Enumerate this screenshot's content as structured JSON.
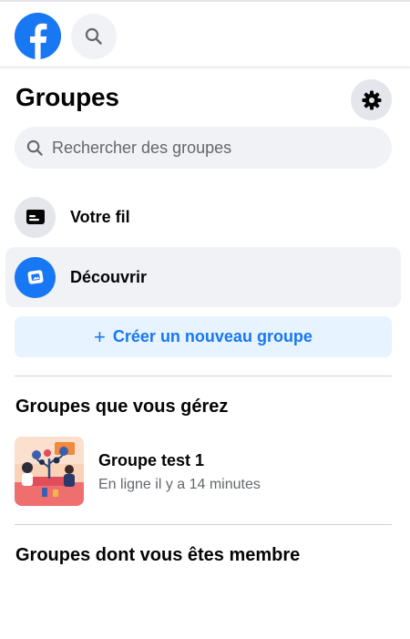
{
  "header": {
    "logo_icon": "facebook-logo-icon",
    "search_icon": "search-icon"
  },
  "page": {
    "title": "Groupes",
    "settings_icon": "gear-icon"
  },
  "search": {
    "placeholder": "Rechercher des groupes"
  },
  "nav": {
    "items": [
      {
        "label": "Votre fil",
        "icon": "feed-icon",
        "active": false
      },
      {
        "label": "Découvrir",
        "icon": "discover-icon",
        "active": true
      }
    ]
  },
  "create": {
    "label": "Créer un nouveau groupe"
  },
  "sections": {
    "managed_title": "Groupes que vous gérez",
    "member_title": "Groupes dont vous êtes membre"
  },
  "groups": [
    {
      "name": "Groupe test 1",
      "status": "En ligne il y a 14 minutes"
    }
  ],
  "colors": {
    "brand": "#1877f2",
    "light_blue": "#e7f3ff",
    "gray_bg": "#f0f2f5",
    "secondary_text": "#65676b"
  }
}
